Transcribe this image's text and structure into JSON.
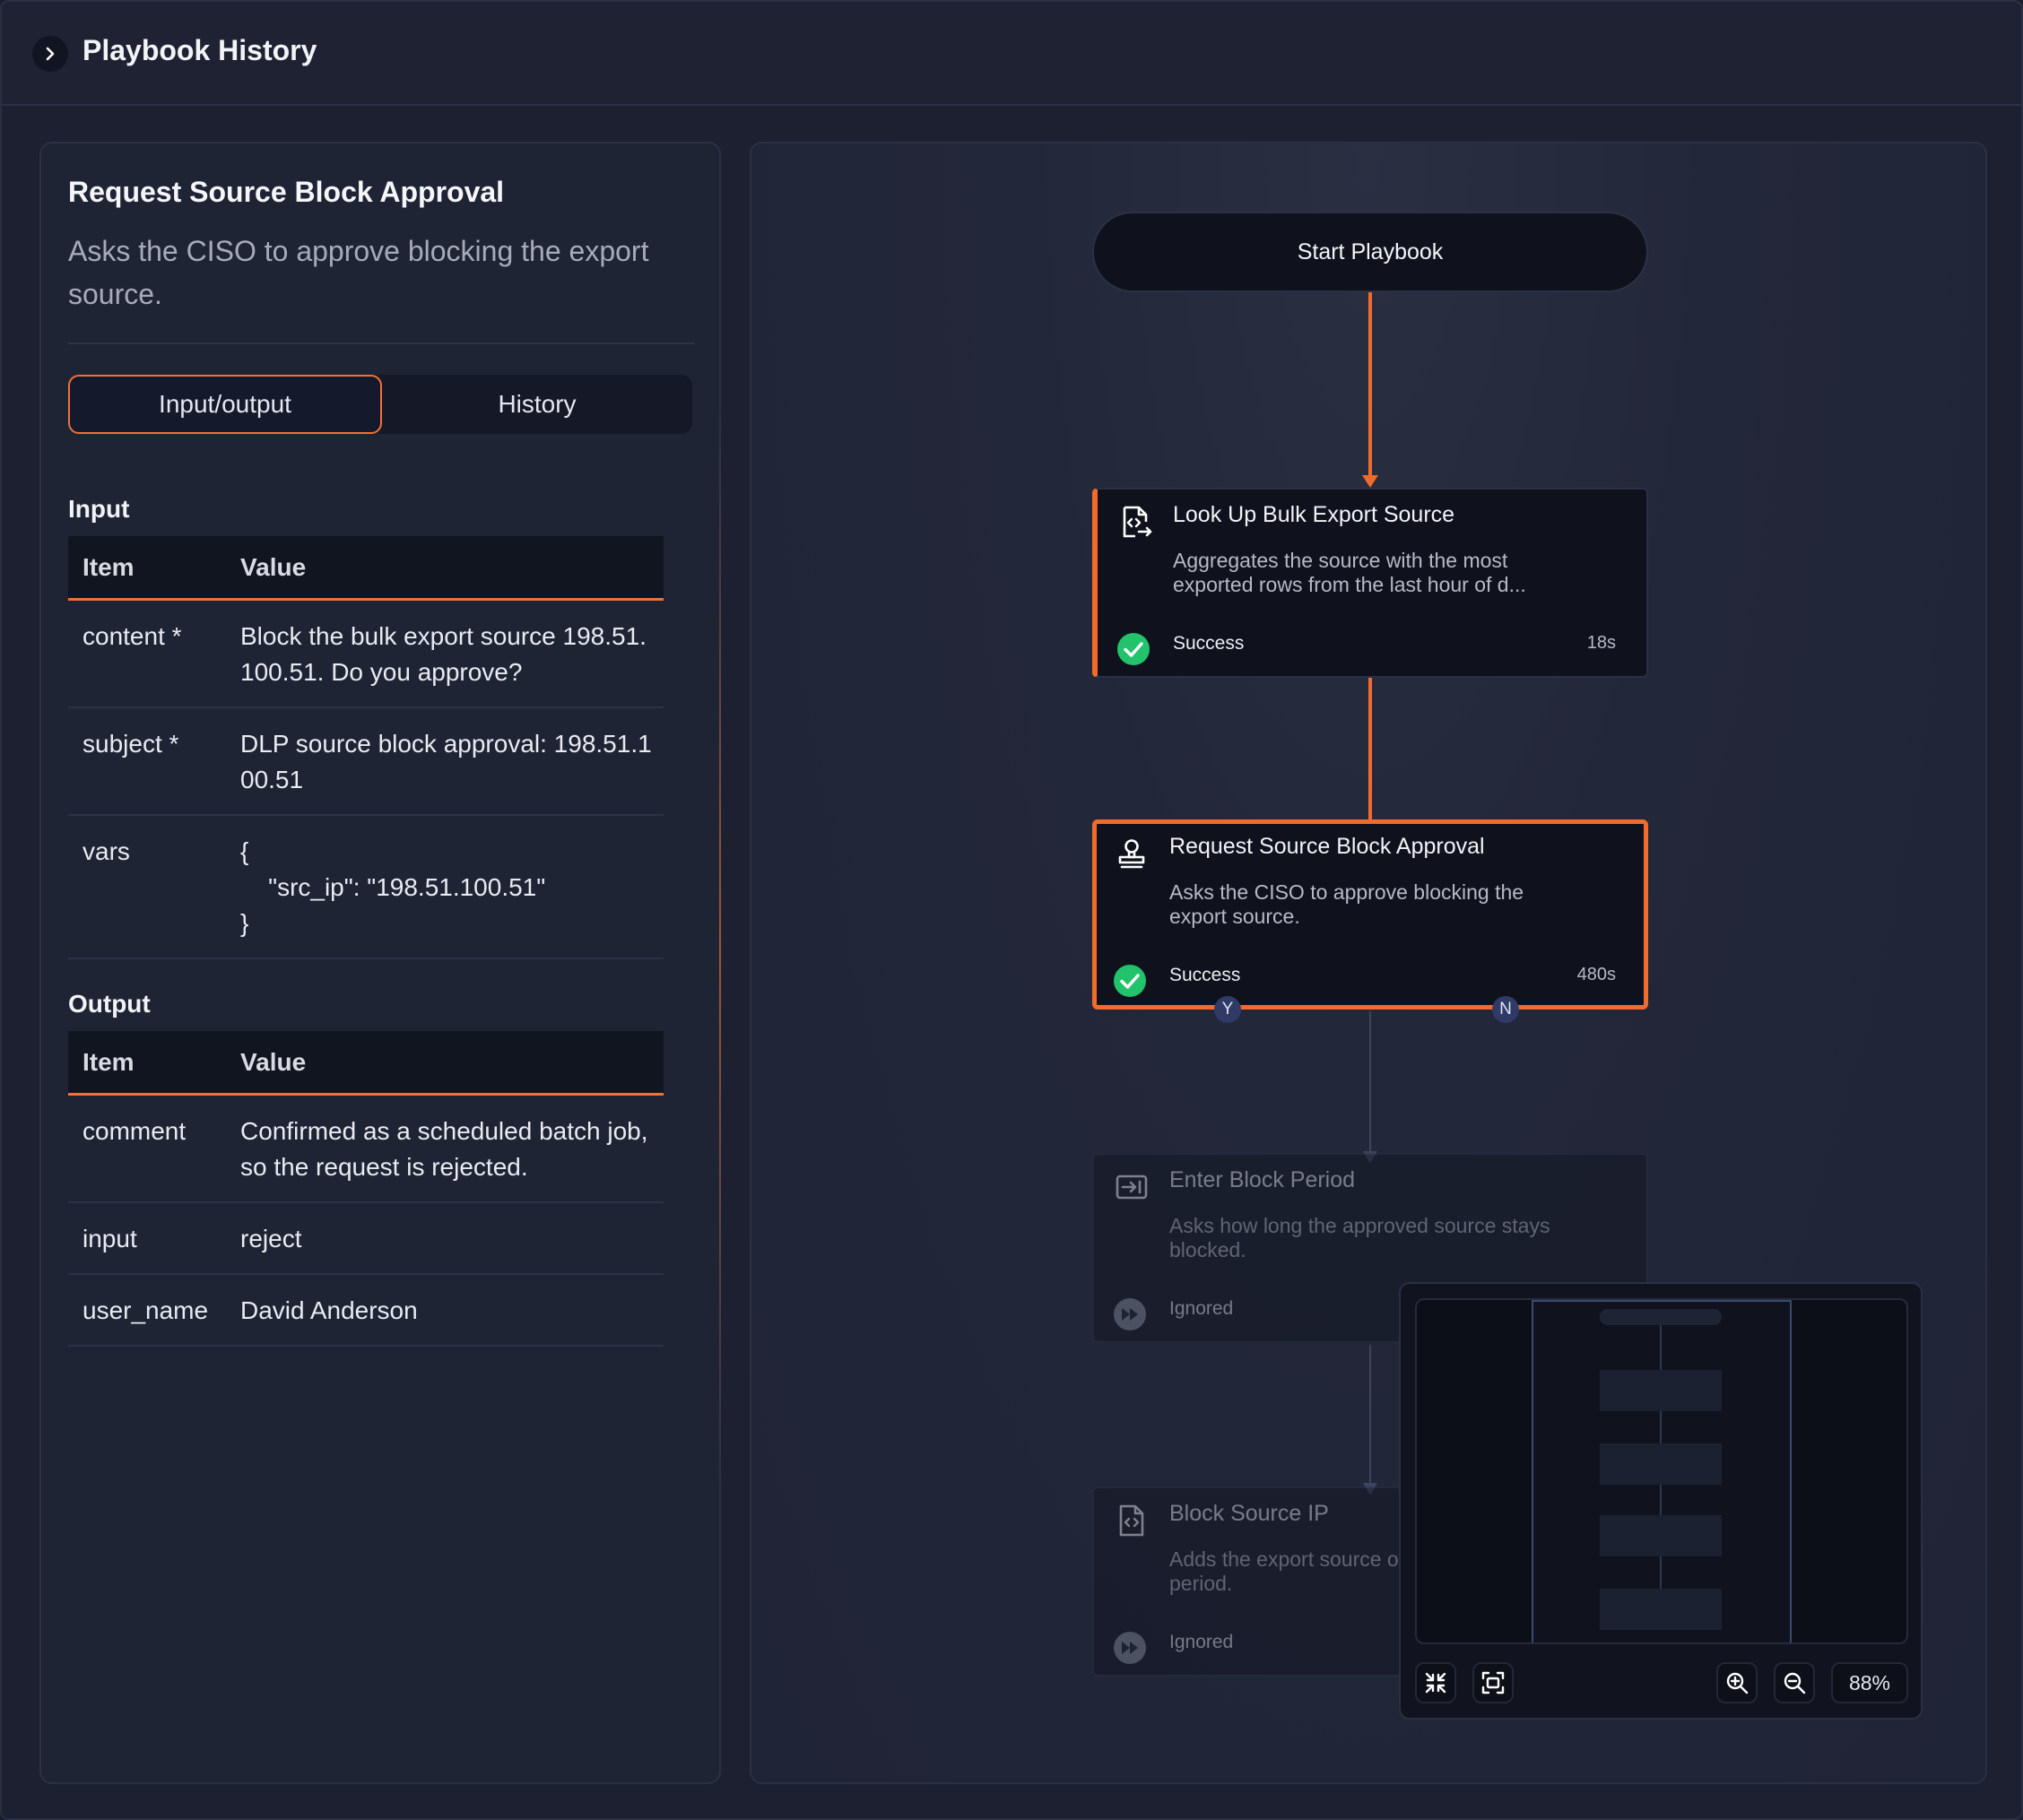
{
  "header": {
    "title": "Playbook History"
  },
  "left_panel": {
    "node_title": "Request Source Block Approval",
    "node_description": "Asks the CISO to approve blocking the export source.",
    "tabs": [
      {
        "label": "Input/output",
        "active": true
      },
      {
        "label": "History",
        "active": false
      }
    ],
    "input": {
      "title": "Input",
      "columns": [
        "Item",
        "Value"
      ],
      "rows": [
        {
          "key": "content *",
          "value": "Block the bulk export source 198.51.100.51. Do you approve?"
        },
        {
          "key": "subject *",
          "value": "DLP source block approval: 198.51.100.51"
        },
        {
          "key": "vars",
          "value": "{\n    \"src_ip\": \"198.51.100.51\"\n}"
        }
      ]
    },
    "output": {
      "title": "Output",
      "columns": [
        "Item",
        "Value"
      ],
      "rows": [
        {
          "key": "comment",
          "value": "Confirmed as a scheduled batch job, so the request is rejected."
        },
        {
          "key": "input",
          "value": "reject"
        },
        {
          "key": "user_name",
          "value": "David Anderson"
        }
      ]
    }
  },
  "flow": {
    "start_label": "Start Playbook",
    "nodes": [
      {
        "title": "Look Up Bulk Export Source",
        "description": "Aggregates the source with the most exported rows from the last hour of d...",
        "status": "Success",
        "duration": "18s",
        "icon": "code-file-arrow-icon"
      },
      {
        "title": "Request Source Block Approval",
        "description": "Asks the CISO to approve blocking the export source.",
        "status": "Success",
        "duration": "480s",
        "icon": "approval-stamp-icon"
      },
      {
        "title": "Enter Block Period",
        "description": "Asks how long the approved source stays blocked.",
        "status": "Ignored",
        "icon": "input-arrow-icon"
      },
      {
        "title": "Block Source IP",
        "description": "Adds the export source or the selected period.",
        "status": "Ignored",
        "icon": "code-file-icon"
      }
    ],
    "ports": {
      "yes": "Y",
      "no": "N"
    }
  },
  "minimap": {
    "zoom": "88%"
  },
  "colors": {
    "accent": "#f26b2c",
    "success": "#22c36b",
    "background": "#1c2030"
  }
}
